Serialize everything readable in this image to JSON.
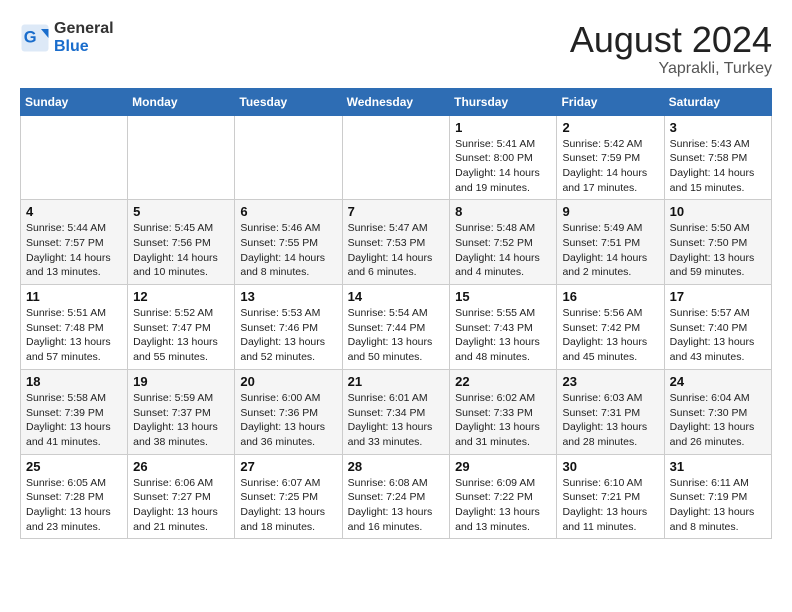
{
  "header": {
    "logo_general": "General",
    "logo_blue": "Blue",
    "month_year": "August 2024",
    "location": "Yaprakli, Turkey"
  },
  "days_of_week": [
    "Sunday",
    "Monday",
    "Tuesday",
    "Wednesday",
    "Thursday",
    "Friday",
    "Saturday"
  ],
  "weeks": [
    [
      {
        "day": "",
        "info": ""
      },
      {
        "day": "",
        "info": ""
      },
      {
        "day": "",
        "info": ""
      },
      {
        "day": "",
        "info": ""
      },
      {
        "day": "1",
        "info": "Sunrise: 5:41 AM\nSunset: 8:00 PM\nDaylight: 14 hours\nand 19 minutes."
      },
      {
        "day": "2",
        "info": "Sunrise: 5:42 AM\nSunset: 7:59 PM\nDaylight: 14 hours\nand 17 minutes."
      },
      {
        "day": "3",
        "info": "Sunrise: 5:43 AM\nSunset: 7:58 PM\nDaylight: 14 hours\nand 15 minutes."
      }
    ],
    [
      {
        "day": "4",
        "info": "Sunrise: 5:44 AM\nSunset: 7:57 PM\nDaylight: 14 hours\nand 13 minutes."
      },
      {
        "day": "5",
        "info": "Sunrise: 5:45 AM\nSunset: 7:56 PM\nDaylight: 14 hours\nand 10 minutes."
      },
      {
        "day": "6",
        "info": "Sunrise: 5:46 AM\nSunset: 7:55 PM\nDaylight: 14 hours\nand 8 minutes."
      },
      {
        "day": "7",
        "info": "Sunrise: 5:47 AM\nSunset: 7:53 PM\nDaylight: 14 hours\nand 6 minutes."
      },
      {
        "day": "8",
        "info": "Sunrise: 5:48 AM\nSunset: 7:52 PM\nDaylight: 14 hours\nand 4 minutes."
      },
      {
        "day": "9",
        "info": "Sunrise: 5:49 AM\nSunset: 7:51 PM\nDaylight: 14 hours\nand 2 minutes."
      },
      {
        "day": "10",
        "info": "Sunrise: 5:50 AM\nSunset: 7:50 PM\nDaylight: 13 hours\nand 59 minutes."
      }
    ],
    [
      {
        "day": "11",
        "info": "Sunrise: 5:51 AM\nSunset: 7:48 PM\nDaylight: 13 hours\nand 57 minutes."
      },
      {
        "day": "12",
        "info": "Sunrise: 5:52 AM\nSunset: 7:47 PM\nDaylight: 13 hours\nand 55 minutes."
      },
      {
        "day": "13",
        "info": "Sunrise: 5:53 AM\nSunset: 7:46 PM\nDaylight: 13 hours\nand 52 minutes."
      },
      {
        "day": "14",
        "info": "Sunrise: 5:54 AM\nSunset: 7:44 PM\nDaylight: 13 hours\nand 50 minutes."
      },
      {
        "day": "15",
        "info": "Sunrise: 5:55 AM\nSunset: 7:43 PM\nDaylight: 13 hours\nand 48 minutes."
      },
      {
        "day": "16",
        "info": "Sunrise: 5:56 AM\nSunset: 7:42 PM\nDaylight: 13 hours\nand 45 minutes."
      },
      {
        "day": "17",
        "info": "Sunrise: 5:57 AM\nSunset: 7:40 PM\nDaylight: 13 hours\nand 43 minutes."
      }
    ],
    [
      {
        "day": "18",
        "info": "Sunrise: 5:58 AM\nSunset: 7:39 PM\nDaylight: 13 hours\nand 41 minutes."
      },
      {
        "day": "19",
        "info": "Sunrise: 5:59 AM\nSunset: 7:37 PM\nDaylight: 13 hours\nand 38 minutes."
      },
      {
        "day": "20",
        "info": "Sunrise: 6:00 AM\nSunset: 7:36 PM\nDaylight: 13 hours\nand 36 minutes."
      },
      {
        "day": "21",
        "info": "Sunrise: 6:01 AM\nSunset: 7:34 PM\nDaylight: 13 hours\nand 33 minutes."
      },
      {
        "day": "22",
        "info": "Sunrise: 6:02 AM\nSunset: 7:33 PM\nDaylight: 13 hours\nand 31 minutes."
      },
      {
        "day": "23",
        "info": "Sunrise: 6:03 AM\nSunset: 7:31 PM\nDaylight: 13 hours\nand 28 minutes."
      },
      {
        "day": "24",
        "info": "Sunrise: 6:04 AM\nSunset: 7:30 PM\nDaylight: 13 hours\nand 26 minutes."
      }
    ],
    [
      {
        "day": "25",
        "info": "Sunrise: 6:05 AM\nSunset: 7:28 PM\nDaylight: 13 hours\nand 23 minutes."
      },
      {
        "day": "26",
        "info": "Sunrise: 6:06 AM\nSunset: 7:27 PM\nDaylight: 13 hours\nand 21 minutes."
      },
      {
        "day": "27",
        "info": "Sunrise: 6:07 AM\nSunset: 7:25 PM\nDaylight: 13 hours\nand 18 minutes."
      },
      {
        "day": "28",
        "info": "Sunrise: 6:08 AM\nSunset: 7:24 PM\nDaylight: 13 hours\nand 16 minutes."
      },
      {
        "day": "29",
        "info": "Sunrise: 6:09 AM\nSunset: 7:22 PM\nDaylight: 13 hours\nand 13 minutes."
      },
      {
        "day": "30",
        "info": "Sunrise: 6:10 AM\nSunset: 7:21 PM\nDaylight: 13 hours\nand 11 minutes."
      },
      {
        "day": "31",
        "info": "Sunrise: 6:11 AM\nSunset: 7:19 PM\nDaylight: 13 hours\nand 8 minutes."
      }
    ]
  ]
}
